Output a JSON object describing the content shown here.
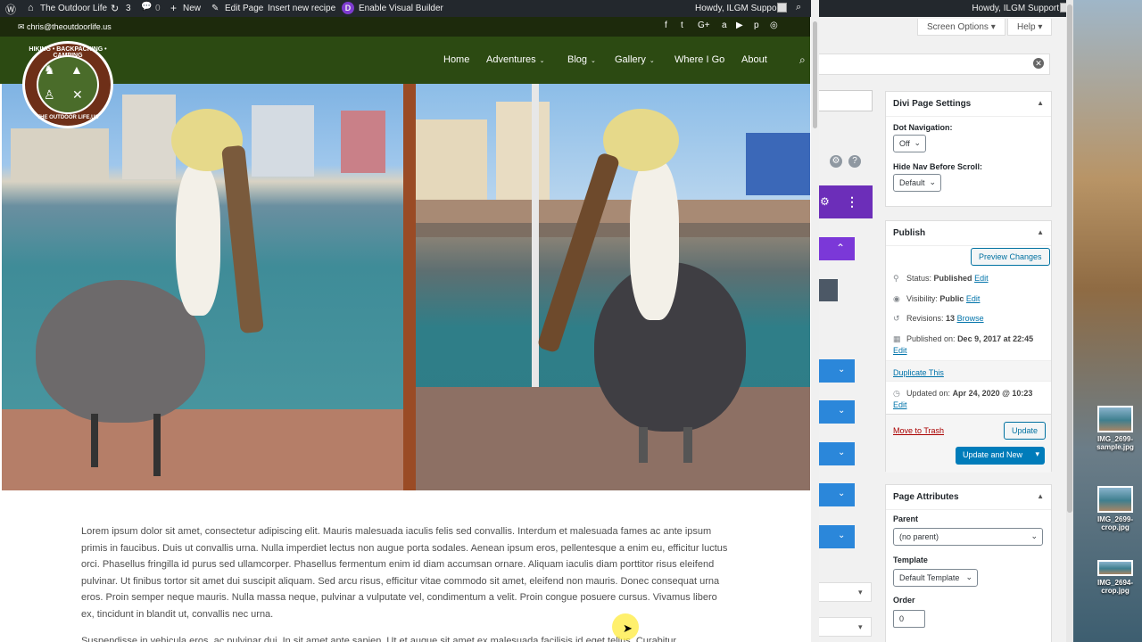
{
  "front": {
    "adminbar": {
      "site_name": "The Outdoor Life",
      "updates_count": "3",
      "comments_count": "0",
      "new_label": "New",
      "edit_page_label": "Edit Page",
      "insert_recipe_label": "Insert new recipe",
      "visual_builder_label": "Enable Visual Builder",
      "howdy": "Howdy, ILGM Support"
    },
    "topstrip": {
      "email": "chris@theoutdoorlife.us",
      "social": [
        "f",
        "t",
        "G+",
        "a",
        "▶",
        "p",
        "◎"
      ]
    },
    "logo": {
      "top_text": "HIKING • BACKPACKING • CAMPING",
      "bottom_text": "THE OUTDOOR LIFE.US"
    },
    "nav": [
      {
        "label": "Home",
        "caret": ""
      },
      {
        "label": "Adventures",
        "caret": "⌄"
      },
      {
        "label": "Blog",
        "caret": "⌄"
      },
      {
        "label": "Gallery",
        "caret": "⌄"
      },
      {
        "label": "Where I Go",
        "caret": ""
      },
      {
        "label": "About",
        "caret": ""
      }
    ],
    "article_p1": "Lorem ipsum dolor sit amet, consectetur adipiscing elit. Mauris malesuada iaculis felis sed convallis. Interdum et malesuada fames ac ante ipsum primis in faucibus. Duis ut convallis urna. Nulla imperdiet lectus non augue porta sodales. Aenean ipsum eros, pellentesque a enim eu, efficitur luctus orci. Phasellus fringilla id purus sed ullamcorper. Phasellus fermentum enim id diam accumsan ornare. Aliquam iaculis diam porttitor risus eleifend pulvinar. Ut finibus tortor sit amet dui suscipit aliquam. Sed arcu risus, efficitur vitae commodo sit amet, eleifend non mauris. Donec consequat urna eros. Proin semper neque mauris. Nulla massa neque, pulvinar a vulputate vel, condimentum a velit. Proin congue posuere cursus. Vivamus libero ex, tincidunt in blandit ut, convallis nec urna.",
    "article_p2": "Suspendisse in vehicula eros, ac pulvinar dui. In sit amet ante sapien. Ut et augue sit amet ex malesuada facilisis id eget tellus. Curabitur"
  },
  "admin": {
    "howdy": "Howdy, ILGM Support",
    "screen_options": "Screen Options ▾",
    "help": "Help ▾",
    "divi_settings": {
      "title": "Divi Page Settings",
      "dot_nav_label": "Dot Navigation:",
      "dot_nav_value": "Off",
      "hide_nav_label": "Hide Nav Before Scroll:",
      "hide_nav_value": "Default"
    },
    "publish": {
      "title": "Publish",
      "preview": "Preview Changes",
      "status_label": "Status:",
      "status_value": "Published",
      "visibility_label": "Visibility:",
      "visibility_value": "Public",
      "revisions_label": "Revisions:",
      "revisions_value": "13",
      "browse": "Browse",
      "published_on_label": "Published on:",
      "published_on_value": "Dec 9, 2017 at 22:45",
      "edit": "Edit",
      "duplicate": "Duplicate This",
      "updated_on_label": "Updated on:",
      "updated_on_value": "Apr 24, 2020 @ 10:23",
      "trash": "Move to Trash",
      "update": "Update",
      "update_new": "Update and New"
    },
    "page_attributes": {
      "title": "Page Attributes",
      "parent_label": "Parent",
      "parent_value": "(no parent)",
      "template_label": "Template",
      "template_value": "Default Template",
      "order_label": "Order",
      "order_value": "0"
    }
  },
  "desktop_icons": [
    {
      "label": "IMG_2699-sample.jpg"
    },
    {
      "label": "IMG_2699-crop.jpg"
    },
    {
      "label": "IMG_2694-crop.jpg"
    }
  ]
}
